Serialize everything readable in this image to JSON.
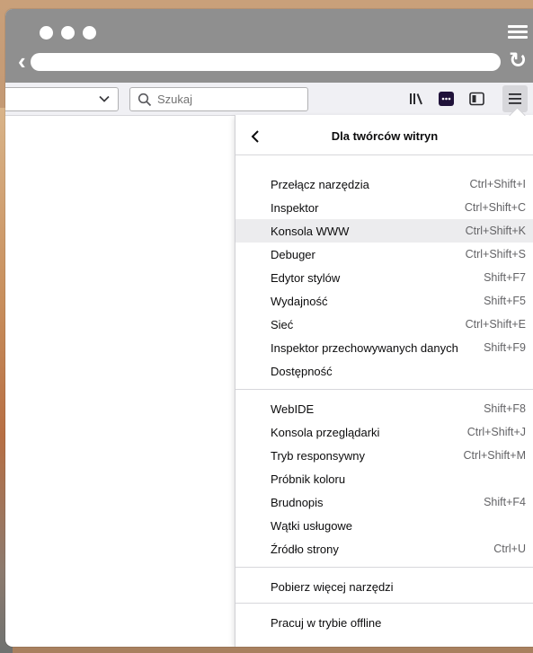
{
  "toolbar": {
    "search_placeholder": "Szukaj"
  },
  "panel": {
    "title": "Dla twórców witryn",
    "groups": [
      [
        {
          "label": "Przełącz narzędzia",
          "shortcut": "Ctrl+Shift+I"
        },
        {
          "label": "Inspektor",
          "shortcut": "Ctrl+Shift+C"
        },
        {
          "label": "Konsola WWW",
          "shortcut": "Ctrl+Shift+K",
          "highlighted": true
        },
        {
          "label": "Debuger",
          "shortcut": "Ctrl+Shift+S"
        },
        {
          "label": "Edytor stylów",
          "shortcut": "Shift+F7"
        },
        {
          "label": "Wydajność",
          "shortcut": "Shift+F5"
        },
        {
          "label": "Sieć",
          "shortcut": "Ctrl+Shift+E"
        },
        {
          "label": "Inspektor przechowywanych danych",
          "shortcut": "Shift+F9"
        },
        {
          "label": "Dostępność",
          "shortcut": ""
        }
      ],
      [
        {
          "label": "WebIDE",
          "shortcut": "Shift+F8"
        },
        {
          "label": "Konsola przeglądarki",
          "shortcut": "Ctrl+Shift+J"
        },
        {
          "label": "Tryb responsywny",
          "shortcut": "Ctrl+Shift+M"
        },
        {
          "label": "Próbnik koloru",
          "shortcut": ""
        },
        {
          "label": "Brudnopis",
          "shortcut": "Shift+F4"
        },
        {
          "label": "Wątki usługowe",
          "shortcut": ""
        },
        {
          "label": "Źródło strony",
          "shortcut": "Ctrl+U"
        }
      ],
      [
        {
          "label": "Pobierz więcej narzędzi",
          "shortcut": ""
        }
      ],
      [
        {
          "label": "Pracuj w trybie offline",
          "shortcut": ""
        }
      ]
    ]
  },
  "colors": {
    "titlebar": "#8f8f8f",
    "toolbar": "#f0f0f4",
    "highlight": "#ececee",
    "accent_icon": "#20123a"
  }
}
